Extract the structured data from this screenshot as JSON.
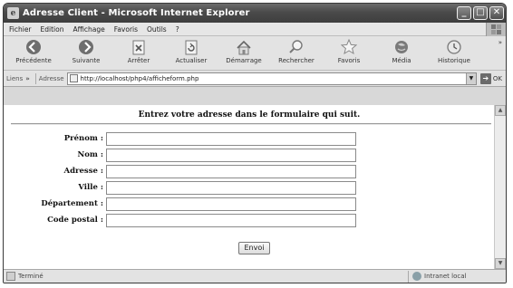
{
  "window": {
    "title": "Adresse Client - Microsoft Internet Explorer"
  },
  "window_buttons": {
    "minimize": "_",
    "maximize": "□",
    "close": "✕"
  },
  "menu": [
    "Fichier",
    "Edition",
    "Affichage",
    "Favoris",
    "Outils",
    "?"
  ],
  "toolbar": {
    "buttons": [
      {
        "label": "Précédente",
        "icon": "back-icon"
      },
      {
        "label": "Suivante",
        "icon": "forward-icon"
      },
      {
        "label": "Arrêter",
        "icon": "stop-icon"
      },
      {
        "label": "Actualiser",
        "icon": "refresh-icon"
      },
      {
        "label": "Démarrage",
        "icon": "home-icon"
      },
      {
        "label": "Rechercher",
        "icon": "search-icon"
      },
      {
        "label": "Favoris",
        "icon": "favorites-icon"
      },
      {
        "label": "Média",
        "icon": "media-icon"
      },
      {
        "label": "Historique",
        "icon": "history-icon"
      }
    ],
    "overflow": "»"
  },
  "addressbar": {
    "links_label": "Liens",
    "links_chevron": "»",
    "address_label": "Adresse",
    "url": "http://localhost/php4/afficheform.php",
    "go_label": "OK"
  },
  "page": {
    "heading": "Entrez votre adresse dans le formulaire qui suit.",
    "fields": [
      {
        "label": "Prénom :",
        "value": ""
      },
      {
        "label": "Nom :",
        "value": ""
      },
      {
        "label": "Adresse :",
        "value": ""
      },
      {
        "label": "Ville :",
        "value": ""
      },
      {
        "label": "Département :",
        "value": ""
      },
      {
        "label": "Code postal :",
        "value": ""
      }
    ],
    "submit_label": "Envoi"
  },
  "statusbar": {
    "status": "Terminé",
    "zone": "Intranet local"
  }
}
